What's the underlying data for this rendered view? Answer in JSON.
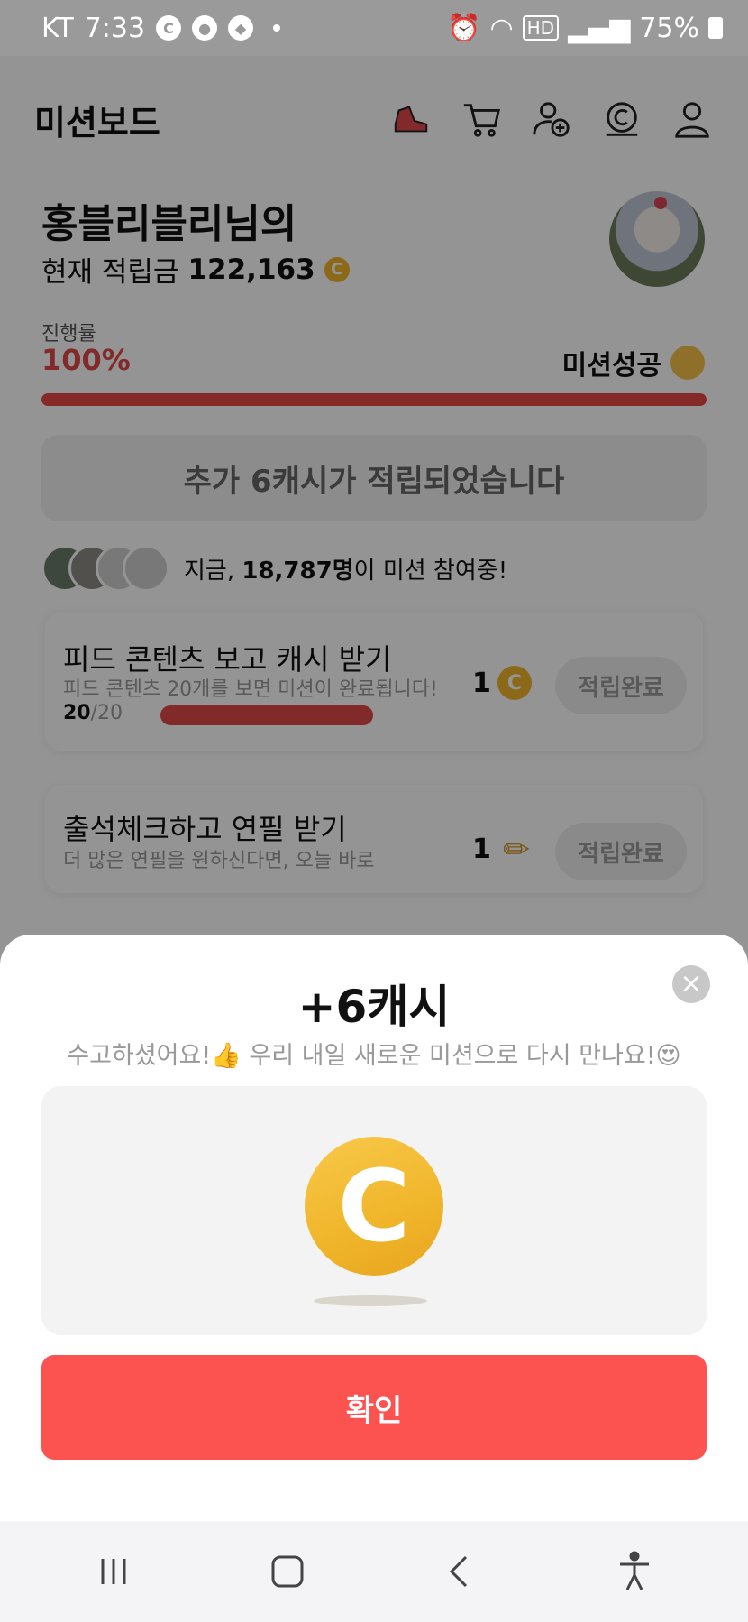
{
  "status_bar": {
    "carrier": "KT",
    "time": "7:33",
    "icons": [
      "c-app-icon",
      "lock-app-icon",
      "chat-icon"
    ],
    "hd_label": "HD",
    "battery": "75%"
  },
  "header": {
    "title": "미션보드",
    "icons": [
      "shoe-icon",
      "cart-icon",
      "add-friend-icon",
      "coin-icon",
      "profile-icon"
    ]
  },
  "user": {
    "name": "홍블리블리님의",
    "balance_label": "현재 적립금",
    "balance_value": "122,163",
    "coin_symbol": "C"
  },
  "progress": {
    "label": "진행률",
    "percent": "100%",
    "value": 1.0,
    "status": "미션성공"
  },
  "notice": "추가 6캐시가 적립되었습니다",
  "participants": {
    "prefix": "지금, ",
    "count": "18,787명",
    "suffix": "이 미션 참여중!"
  },
  "missions": [
    {
      "title": "피드 콘텐츠 보고 캐시 받기",
      "desc": "피드 콘텐츠 20개를 보면 미션이 완료됩니다!",
      "count_done": "20",
      "count_total": "/20",
      "progress": 1.0,
      "reward_amount": "1",
      "reward_symbol": "C",
      "button": "적립완료"
    },
    {
      "title": "출석체크하고 연필 받기",
      "desc": "더 많은 연필을 원하신다면, 오늘 바로",
      "reward_amount": "1",
      "reward_symbol": "✏",
      "button": "적립완료"
    }
  ],
  "sheet": {
    "title": "+6캐시",
    "subtitle": "수고하셨어요!👍 우리 내일 새로운 미션으로 다시 만나요!😍",
    "coin_symbol": "C",
    "confirm": "확인",
    "close": "×"
  },
  "nav": [
    "recent-apps-icon",
    "home-icon",
    "back-icon",
    "accessibility-icon"
  ],
  "colors": {
    "accent_red": "#fc5350",
    "progress_red": "#e54848",
    "coin_yellow": "#f0b52a"
  }
}
